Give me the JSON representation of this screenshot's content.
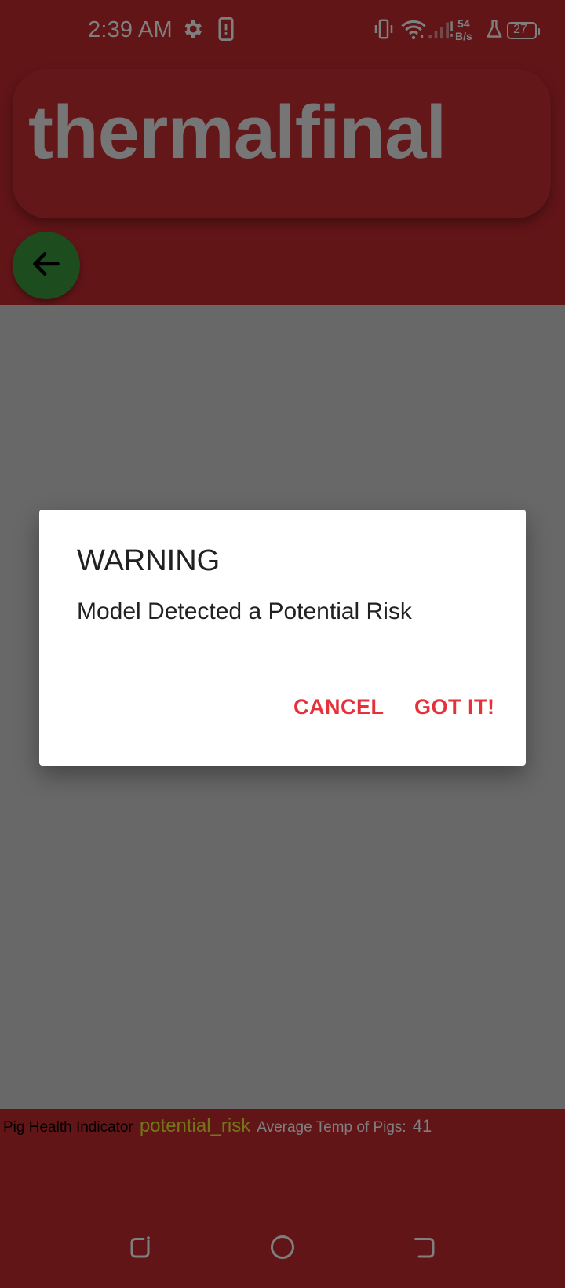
{
  "status_bar": {
    "time": "2:39 AM",
    "net_speed_value": "54",
    "net_speed_unit": "B/s",
    "battery_level": "27",
    "icons": [
      "gear-icon",
      "device-icon",
      "vibrate-icon",
      "wifi-icon",
      "signal-icon",
      "lab-icon",
      "battery-icon"
    ]
  },
  "app": {
    "title": "thermalfinal",
    "back_icon": "arrow-left-icon"
  },
  "info_bar": {
    "health_label": "Pig Health Indicator",
    "health_value": "potential_risk",
    "temp_label": "Average Temp of Pigs:",
    "temp_value": "41"
  },
  "dialog": {
    "title": "WARNING",
    "message": "Model Detected a Potential Risk",
    "cancel_label": "CANCEL",
    "confirm_label": "GOT IT!"
  },
  "nav_bar": {
    "icons": [
      "recents-icon",
      "home-icon",
      "back-icon"
    ]
  },
  "colors": {
    "app_background": "#c42a2f",
    "fab_green": "#3b9a3e",
    "dialog_button": "#e5323a",
    "health_value": "#e8ea33"
  }
}
